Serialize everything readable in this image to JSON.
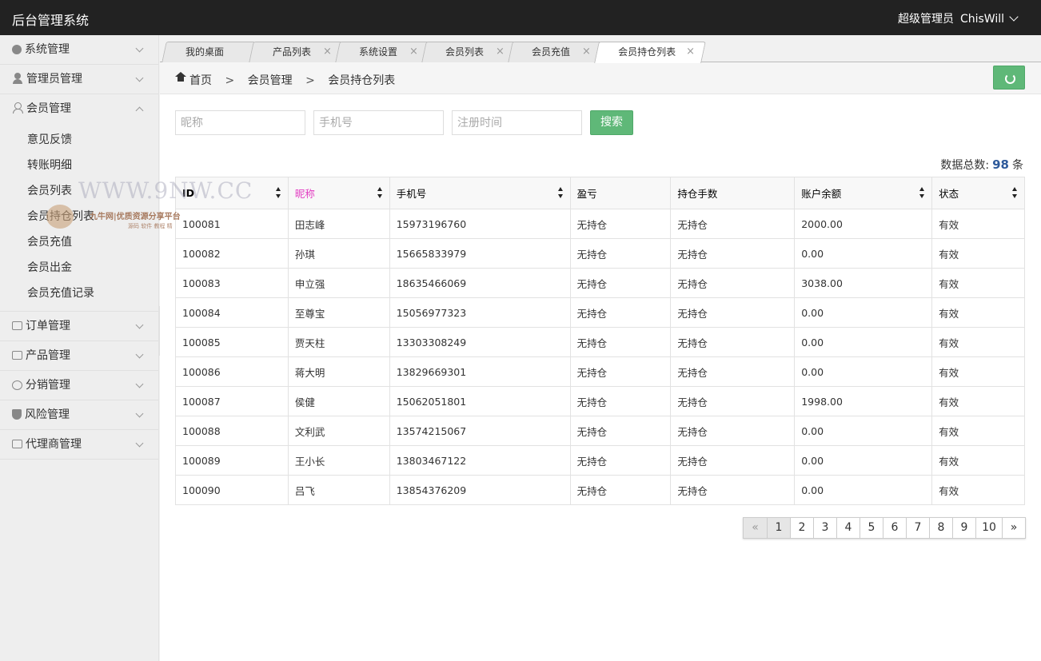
{
  "header": {
    "app_title": "后台管理系统",
    "role": "超级管理员",
    "username": "ChisWill"
  },
  "sidebar": {
    "items": [
      {
        "label": "系统管理",
        "icon": "gear-icon"
      },
      {
        "label": "管理员管理",
        "icon": "user-icon"
      },
      {
        "label": "会员管理",
        "icon": "user-outline-icon",
        "expanded": true,
        "children": [
          "意见反馈",
          "转账明细",
          "会员列表",
          "会员持仓列表",
          "会员充值",
          "会员出金",
          "会员充值记录"
        ]
      },
      {
        "label": "订单管理",
        "icon": "list-icon"
      },
      {
        "label": "产品管理",
        "icon": "box-icon"
      },
      {
        "label": "分销管理",
        "icon": "chat-icon"
      },
      {
        "label": "风险管理",
        "icon": "shield-icon"
      },
      {
        "label": "代理商管理",
        "icon": "box-icon"
      }
    ]
  },
  "tabs": [
    {
      "label": "我的桌面",
      "closable": false
    },
    {
      "label": "产品列表",
      "closable": true
    },
    {
      "label": "系统设置",
      "closable": true
    },
    {
      "label": "会员列表",
      "closable": true
    },
    {
      "label": "会员充值",
      "closable": true
    },
    {
      "label": "会员持仓列表",
      "closable": true,
      "active": true
    }
  ],
  "tab_close_glyph": "×",
  "breadcrumb": {
    "home": "首页",
    "sep": ">",
    "level1": "会员管理",
    "level2": "会员持仓列表"
  },
  "search": {
    "nickname_placeholder": "昵称",
    "phone_placeholder": "手机号",
    "regtime_placeholder": "注册时间",
    "button": "搜索"
  },
  "total": {
    "label": "数据总数:",
    "count": "98",
    "unit": "条"
  },
  "table": {
    "columns": [
      "ID",
      "昵称",
      "手机号",
      "盈亏",
      "持仓手数",
      "账户余额",
      "状态"
    ],
    "rows": [
      [
        "100081",
        "田志峰",
        "15973196760",
        "无持仓",
        "无持仓",
        "2000.00",
        "有效"
      ],
      [
        "100082",
        "孙琪",
        "15665833979",
        "无持仓",
        "无持仓",
        "0.00",
        "有效"
      ],
      [
        "100083",
        "申立强",
        "18635466069",
        "无持仓",
        "无持仓",
        "3038.00",
        "有效"
      ],
      [
        "100084",
        "至尊宝",
        "15056977323",
        "无持仓",
        "无持仓",
        "0.00",
        "有效"
      ],
      [
        "100085",
        "贾天柱",
        "13303308249",
        "无持仓",
        "无持仓",
        "0.00",
        "有效"
      ],
      [
        "100086",
        "蒋大明",
        "13829669301",
        "无持仓",
        "无持仓",
        "0.00",
        "有效"
      ],
      [
        "100087",
        "侯健",
        "15062051801",
        "无持仓",
        "无持仓",
        "1998.00",
        "有效"
      ],
      [
        "100088",
        "文利武",
        "13574215067",
        "无持仓",
        "无持仓",
        "0.00",
        "有效"
      ],
      [
        "100089",
        "王小长",
        "13803467122",
        "无持仓",
        "无持仓",
        "0.00",
        "有效"
      ],
      [
        "100090",
        "吕飞",
        "13854376209",
        "无持仓",
        "无持仓",
        "0.00",
        "有效"
      ]
    ]
  },
  "pagination": {
    "prev": "«",
    "next": "»",
    "pages": [
      "1",
      "2",
      "3",
      "4",
      "5",
      "6",
      "7",
      "8",
      "9",
      "10"
    ],
    "current": "1"
  },
  "watermark": {
    "site": "WWW.9NW.CC",
    "slogan": "九牛网|优质资源分享平台",
    "tagline": "源码 软件 教程 精"
  },
  "colors": {
    "topbar": "#222222",
    "accent_green": "#5fb878",
    "nickname_header": "#e23cc2",
    "total_count": "#2e5a9b"
  }
}
